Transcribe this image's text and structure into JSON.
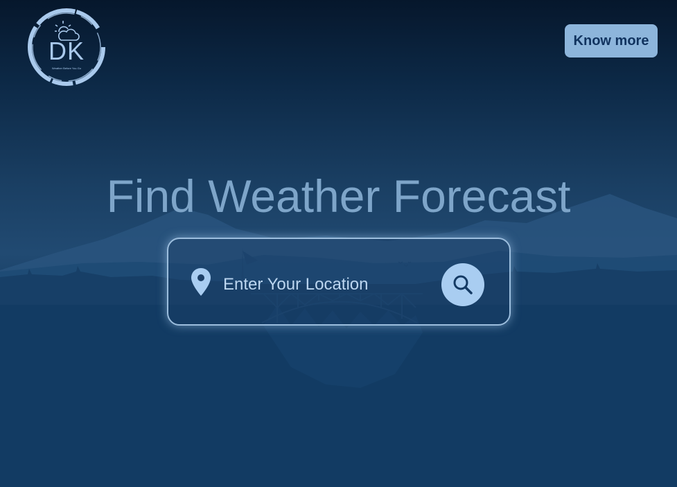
{
  "header": {
    "logo": {
      "letters": "DK",
      "tagline": "Weather Before You Go",
      "icon": "sun-cloud-icon"
    },
    "know_more_label": "Know more"
  },
  "hero": {
    "title": "Find Weather Forecast"
  },
  "search": {
    "placeholder": "Enter Your Location",
    "value": "",
    "location_icon": "map-pin-icon",
    "search_icon": "search-icon"
  },
  "colors": {
    "background_top": "#06172c",
    "background_bottom": "#103a62",
    "accent": "#8db5db",
    "button_text": "#11335f",
    "title_text": "#7ea5c9",
    "input_text": "#bcd6f0",
    "search_button": "#a9cdf1"
  }
}
